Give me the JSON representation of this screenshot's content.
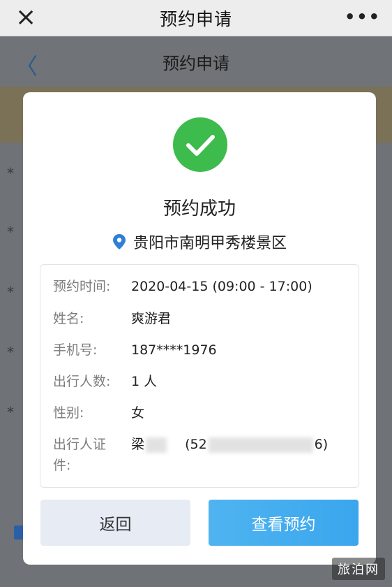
{
  "topbar": {
    "title": "预约申请",
    "close_icon": "×",
    "more_icon": "•••"
  },
  "page": {
    "title": "预约申请",
    "back_icon": "〈"
  },
  "modal": {
    "status_icon": "check-circle-icon",
    "status_text": "预约成功",
    "location_icon": "location-pin-icon",
    "location": "贵阳市南明甲秀楼景区",
    "info": [
      {
        "label": "预约时间:",
        "value": "2020-04-15 (09:00 - 17:00)"
      },
      {
        "label": "姓名:",
        "value": "爽游君"
      },
      {
        "label": "手机号:",
        "value": "187****1976"
      },
      {
        "label": "出行人数:",
        "value": "1 人"
      },
      {
        "label": "性别:",
        "value": "女"
      }
    ],
    "id_row": {
      "label_line1": "出行人证",
      "label_line2": "件:",
      "name_prefix": "梁",
      "id_prefix": "(52",
      "id_suffix": "6)"
    },
    "back_button": "返回",
    "view_button": "查看预约"
  },
  "watermark": "旅泊网",
  "colors": {
    "success": "#3dbb4c",
    "primary": "#3aa6ee",
    "pin": "#2f7fd6"
  }
}
